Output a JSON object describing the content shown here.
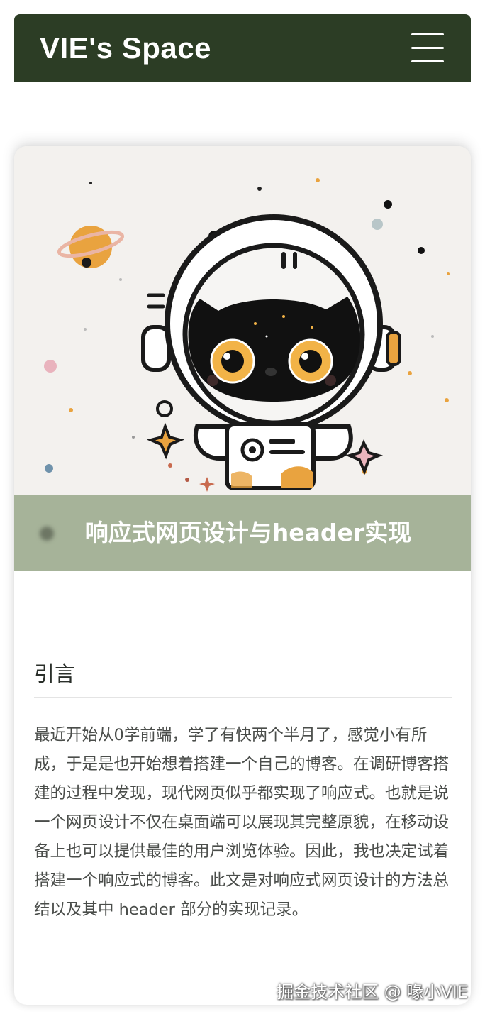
{
  "header": {
    "brand": "VIE's Space",
    "menu_icon": "hamburger-menu-icon"
  },
  "post": {
    "hero_image": "astronaut-black-cat-illustration",
    "title": "响应式网页设计与header实现",
    "section_heading": "引言",
    "paragraph": "最近开始从0学前端，学了有快两个半月了，感觉小有所成，于是是也开始想着搭建一个自己的博客。在调研博客搭建的过程中发现，现代网页似乎都实现了响应式。也就是说一个网页设计不仅在桌面端可以展现其完整原貌，在移动设备上也可以提供最佳的用户浏览体验。因此，我也决定试着搭建一个响应式的博客。此文是对响应式网页设计的方法总结以及其中 header 部分的实现记录。"
  },
  "watermark": "掘金技术社区 @ 喙小VIE",
  "colors": {
    "navbar": "#2c3d25",
    "title_bar": "#a6b399",
    "hero_bg": "#f3f1ee",
    "accent_orange": "#e9a33f"
  }
}
